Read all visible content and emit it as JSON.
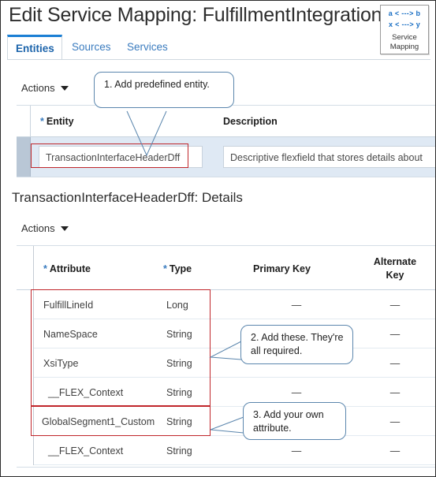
{
  "header": {
    "title": "Edit Service Mapping: FulfillmentIntegration",
    "badge": {
      "line1": "a < ---> b",
      "line2": "x < ---> y",
      "caption_line1": "Service",
      "caption_line2": "Mapping"
    }
  },
  "tabs": [
    {
      "label": "Entities",
      "active": true
    },
    {
      "label": "Sources",
      "active": false
    },
    {
      "label": "Services",
      "active": false
    }
  ],
  "entities_section": {
    "actions_label": "Actions",
    "columns": {
      "entity": "Entity",
      "description": "Description"
    },
    "required_marker": "*",
    "rows": [
      {
        "entity": "TransactionInterfaceHeaderDff",
        "description": "Descriptive flexfield that stores details about"
      }
    ]
  },
  "details_section": {
    "title": "TransactionInterfaceHeaderDff: Details",
    "actions_label": "Actions",
    "columns": {
      "attribute": "Attribute",
      "type": "Type",
      "primary_key": "Primary Key",
      "alternate_key_line1": "Alternate",
      "alternate_key_line2": "Key"
    },
    "required_marker": "*",
    "rows": [
      {
        "attribute": "FulfillLineId",
        "type": "Long",
        "primary_key": "—",
        "alternate_key": "—"
      },
      {
        "attribute": "NameSpace",
        "type": "String",
        "primary_key": "—",
        "alternate_key": "—"
      },
      {
        "attribute": "XsiType",
        "type": "String",
        "primary_key": "—",
        "alternate_key": "—"
      },
      {
        "attribute": "__FLEX_Context",
        "type": "String",
        "primary_key": "—",
        "alternate_key": "—"
      },
      {
        "attribute": "GlobalSegment1_Custom",
        "type": "String",
        "primary_key": "—",
        "alternate_key": "—"
      },
      {
        "attribute": "__FLEX_Context",
        "type": "String",
        "primary_key": "—",
        "alternate_key": "—"
      }
    ]
  },
  "callouts": [
    {
      "id": "callout-1",
      "text": "1. Add predefined  entity."
    },
    {
      "id": "callout-2",
      "text": "2. Add these. They're all required."
    },
    {
      "id": "callout-3",
      "text": "3. Add your own attribute."
    }
  ],
  "colors": {
    "accent_blue": "#1b7fd4",
    "link_blue": "#3b7cbf",
    "highlight_red": "#c0262b",
    "callout_border": "#5b86ad",
    "selected_row": "#dfe9f4"
  }
}
